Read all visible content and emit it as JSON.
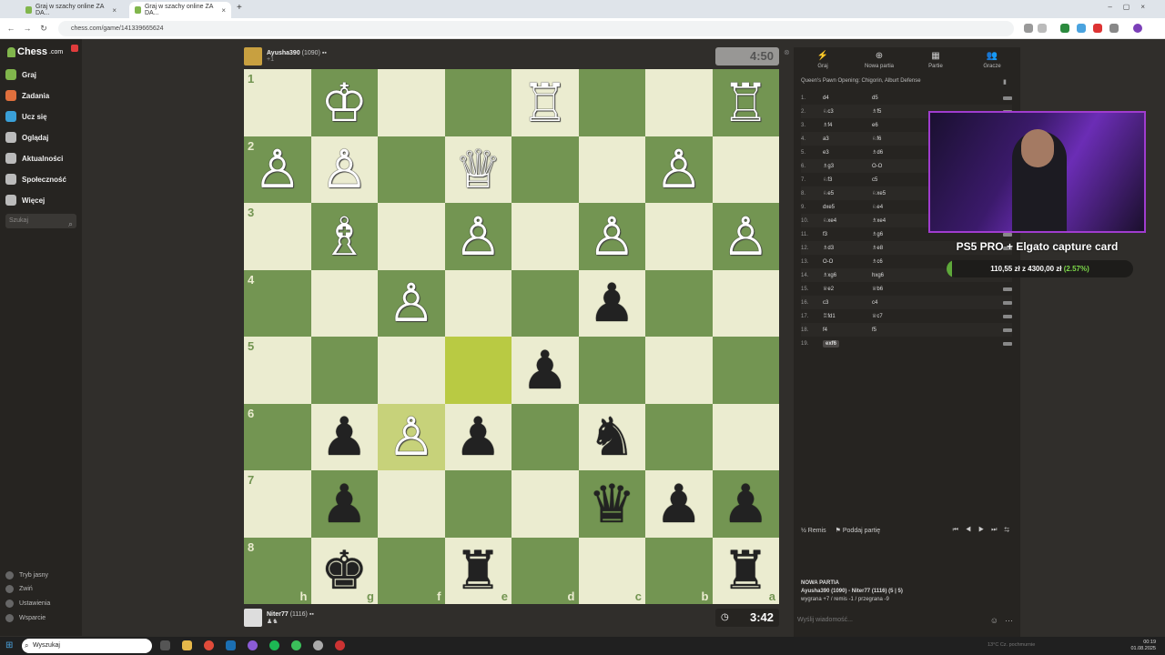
{
  "browser": {
    "tabs": [
      "Graj w szachy online ZA DA...",
      "Graj w szachy online ZA DA..."
    ],
    "new_tab": "+",
    "url": "chess.com/game/141339665624"
  },
  "sidebar": {
    "logo": "Chess",
    "logo_suffix": ".com",
    "items": [
      {
        "label": "Graj",
        "color": "#81b64c"
      },
      {
        "label": "Zadania",
        "color": "#e0703d"
      },
      {
        "label": "Ucz się",
        "color": "#3aa0d8"
      },
      {
        "label": "Oglądaj",
        "color": "#bbbbbb"
      },
      {
        "label": "Aktualności",
        "color": "#bbbbbb"
      },
      {
        "label": "Społeczność",
        "color": "#bbbbbb"
      },
      {
        "label": "Więcej",
        "color": "#bbbbbb"
      }
    ],
    "search_placeholder": "Szukaj",
    "bottom": [
      "Tryb jasny",
      "Zwiń",
      "Ustawienia",
      "Wsparcie"
    ]
  },
  "top_player": {
    "name": "Ayusha390",
    "rating": "(1090)",
    "extra": "+1",
    "clock": "4:50"
  },
  "bottom_player": {
    "name": "Niter77",
    "rating": "(1116)",
    "clock": "3:42"
  },
  "board": {
    "ranks": [
      "1",
      "2",
      "3",
      "4",
      "5",
      "6",
      "7",
      "8"
    ],
    "files": [
      "h",
      "g",
      "f",
      "e",
      "d",
      "c",
      "b",
      "a"
    ],
    "squares": [
      [
        "",
        "wK",
        "",
        "",
        "wR",
        "",
        "",
        "wR"
      ],
      [
        "wP",
        "wP",
        "",
        "wQ",
        "",
        "",
        "wP",
        ""
      ],
      [
        "",
        "wB",
        "",
        "wP",
        "",
        "wP",
        "",
        "wP"
      ],
      [
        "",
        "",
        "wP",
        "",
        "",
        "bP",
        "",
        ""
      ],
      [
        "",
        "",
        "",
        "",
        "bP",
        "",
        "",
        ""
      ],
      [
        "",
        "bP",
        "wP",
        "bP",
        "",
        "bN",
        "",
        ""
      ],
      [
        "",
        "bP",
        "",
        "",
        "",
        "bQ",
        "bP",
        "bP"
      ],
      [
        "",
        "bK",
        "",
        "bR",
        "",
        "",
        "",
        "bR"
      ]
    ],
    "highlights": [
      {
        "r": 4,
        "c": 3,
        "k": "hl"
      },
      {
        "r": 5,
        "c": 2,
        "k": "hl2"
      }
    ]
  },
  "panel": {
    "tabs": [
      {
        "label": "Graj",
        "icon": "⚡"
      },
      {
        "label": "Nowa partia",
        "icon": "⊕"
      },
      {
        "label": "Partie",
        "icon": "▦"
      },
      {
        "label": "Gracze",
        "icon": "👥"
      }
    ],
    "opening": "Queen's Pawn Opening: Chigorin, Alburt Defense",
    "moves": [
      [
        "1.",
        "d4",
        "d5"
      ],
      [
        "2.",
        "♘c3",
        "♗f5"
      ],
      [
        "3.",
        "♗f4",
        "e6"
      ],
      [
        "4.",
        "a3",
        "♘f6"
      ],
      [
        "5.",
        "e3",
        "♗d6"
      ],
      [
        "6.",
        "♗g3",
        "O-O"
      ],
      [
        "7.",
        "♘f3",
        "c5"
      ],
      [
        "8.",
        "♘e5",
        "♘xe5"
      ],
      [
        "9.",
        "dxe5",
        "♘e4"
      ],
      [
        "10.",
        "♘xe4",
        "♗xe4"
      ],
      [
        "11.",
        "f3",
        "♗g6"
      ],
      [
        "12.",
        "♗d3",
        "♗e8"
      ],
      [
        "13.",
        "O-O",
        "♗c6"
      ],
      [
        "14.",
        "♗xg6",
        "hxg6"
      ],
      [
        "15.",
        "♕e2",
        "♕b6"
      ],
      [
        "16.",
        "c3",
        "c4"
      ],
      [
        "17.",
        "♖fd1",
        "♕c7"
      ],
      [
        "18.",
        "f4",
        "f5"
      ],
      [
        "19.",
        "exf6",
        ""
      ]
    ],
    "draw": "½ Remis",
    "resign": "Poddaj partię",
    "nav_icons": "⏮ ◀ ▶ ⏭ ⇆",
    "new_game_title": "NOWA PARTIA",
    "new_game_players": "Ayusha390 (1090) - Niter77 (1116) (5 | 5)",
    "new_game_stats": "wygrana +7 / remis -1 / przegrana -9",
    "chat_placeholder": "Wyślij wiadomość..."
  },
  "overlay": {
    "title": "PS5 PRO + Elgato capture card",
    "amount": "110,55 zł",
    "of": "z 4300,00 zł",
    "percent": "(2.57%)",
    "progress": 0.0257
  },
  "taskbar": {
    "search": "Wyszukaj",
    "time": "00:19",
    "date": "01.08.2025",
    "weather": "13°C Cz. pochmurnie"
  }
}
